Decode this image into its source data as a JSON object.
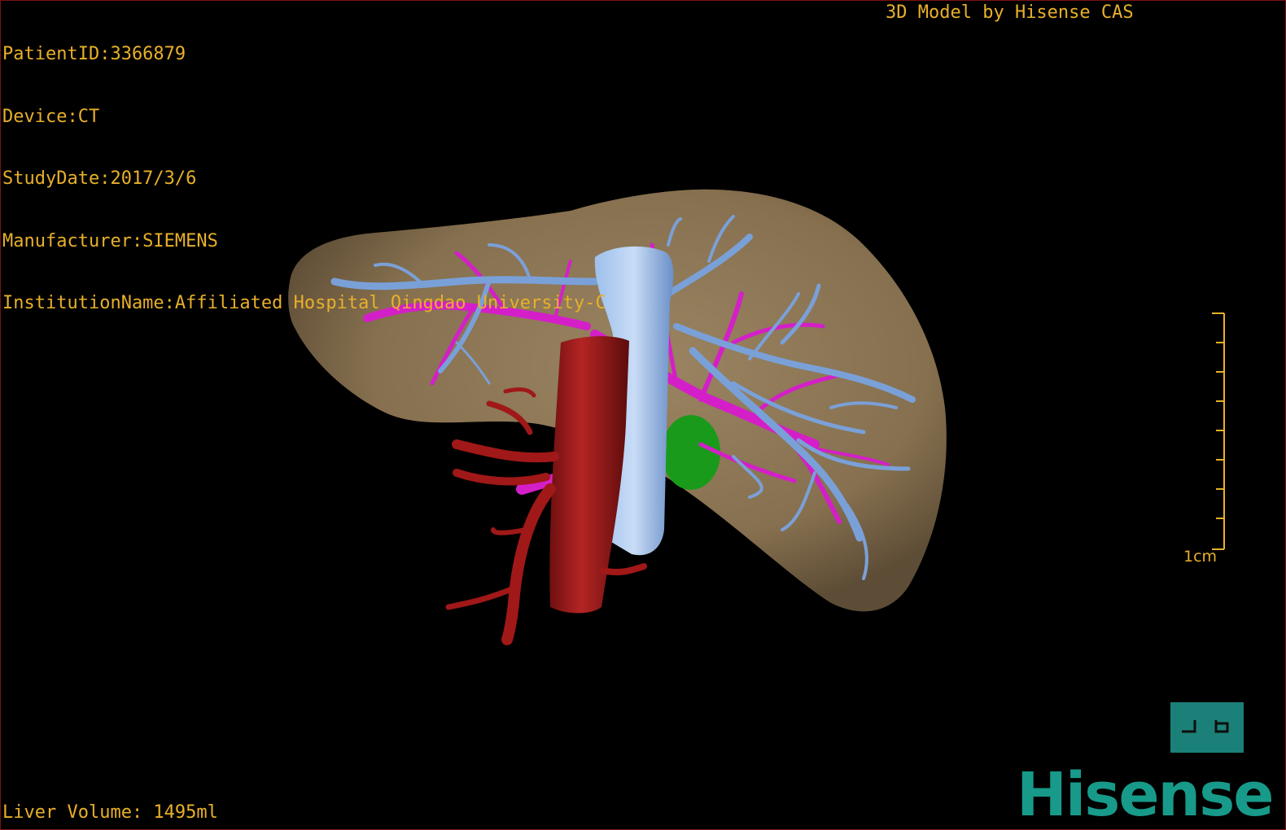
{
  "overlay": {
    "patient": "PatientID:3366879",
    "device": "Device:CT",
    "study_date": "StudyDate:2017/3/6",
    "manufacturer": "Manufacturer:SIEMENS",
    "institution": "InstitutionName:Affiliated Hospital Qingdao University-C",
    "credit": "3D Model by Hisense CAS",
    "liver_volume": "Liver Volume: 1495ml"
  },
  "scale_bar": {
    "label": "1cm"
  },
  "view_button": {
    "icon": "view-orientation-icon"
  },
  "brand": {
    "logo_text": "Hisense"
  },
  "colors": {
    "overlay_text": "#e8b02a",
    "liver": "#8a7455",
    "hepatic_vein": "#7aa0d8",
    "portal_vein": "#d41fc8",
    "artery": "#a01818",
    "gallbladder": "#1a9a1a",
    "brand": "#179a8a"
  }
}
